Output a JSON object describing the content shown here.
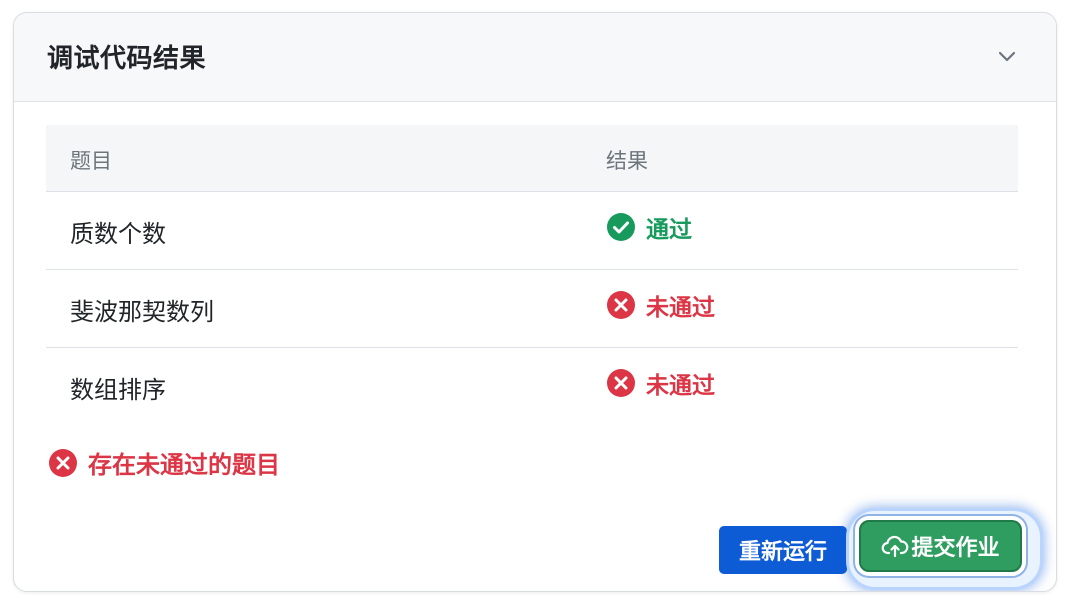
{
  "panel": {
    "title": "调试代码结果"
  },
  "table": {
    "headers": [
      "题目",
      "结果"
    ],
    "rows": [
      {
        "name": "质数个数",
        "status": "pass",
        "result": "通过"
      },
      {
        "name": "斐波那契数列",
        "status": "fail",
        "result": "未通过"
      },
      {
        "name": "数组排序",
        "status": "fail",
        "result": "未通过"
      }
    ]
  },
  "warning": {
    "text": "存在未通过的题目"
  },
  "actions": {
    "rerun_label": "重新运行",
    "submit_label": "提交作业"
  },
  "colors": {
    "pass": "#189a5d",
    "fail": "#dc3545",
    "primary": "#0d5bd5",
    "success": "#2e9d5f"
  },
  "icons": {
    "collapse": "chevron-down-icon",
    "pass": "check-circle-icon",
    "fail": "x-circle-icon",
    "submit": "cloud-upload-icon"
  }
}
